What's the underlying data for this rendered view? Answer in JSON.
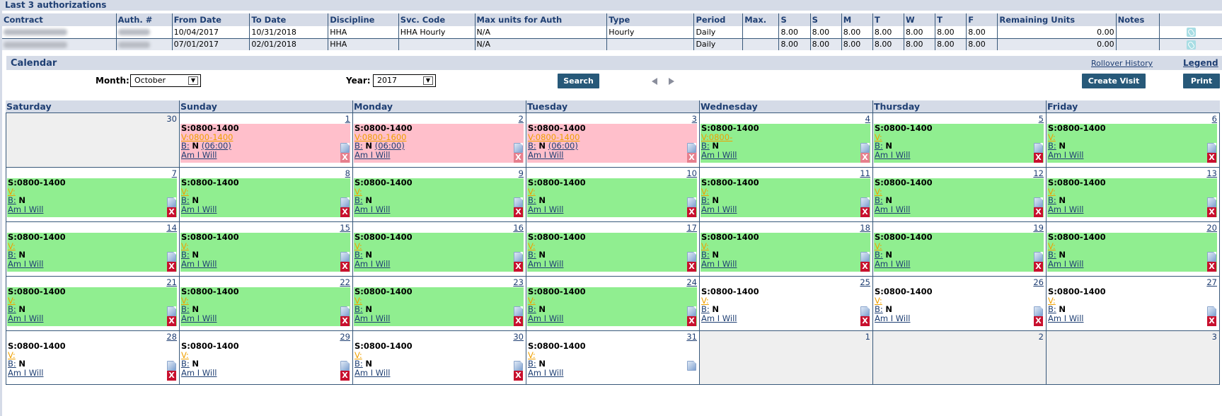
{
  "auth_section": {
    "title": "Last 3 authorizations",
    "columns": [
      "Contract",
      "Auth. #",
      "From Date",
      "To Date",
      "Discipline",
      "Svc. Code",
      "Max units for Auth",
      "Type",
      "Period",
      "Max.",
      "S",
      "S",
      "M",
      "T",
      "W",
      "T",
      "F",
      "Remaining Units",
      "Notes",
      ""
    ],
    "rows": [
      {
        "contract": "",
        "auth": "",
        "from": "10/04/2017",
        "to": "10/31/2018",
        "discipline": "HHA",
        "svc_code": "HHA Hourly",
        "max_units": "N/A",
        "type": "Hourly",
        "period": "Daily",
        "max": "",
        "sat": "8.00",
        "sun": "8.00",
        "mon": "8.00",
        "tue": "8.00",
        "wed": "8.00",
        "thu": "8.00",
        "fri": "8.00",
        "remaining": "0.00",
        "notes": "",
        "icon": "attachment-icon"
      },
      {
        "contract": "",
        "auth": "",
        "from": "07/01/2017",
        "to": "02/01/2018",
        "discipline": "HHA",
        "svc_code": "",
        "max_units": "N/A",
        "type": "",
        "period": "Daily",
        "max": "",
        "sat": "8.00",
        "sun": "8.00",
        "mon": "8.00",
        "tue": "8.00",
        "wed": "8.00",
        "thu": "8.00",
        "fri": "8.00",
        "remaining": "0.00",
        "notes": "",
        "icon": "attachment-icon"
      }
    ]
  },
  "calendar": {
    "title": "Calendar",
    "rollover_label": "Rollover History",
    "legend_label": "Legend",
    "month_label": "Month:",
    "month_value": "October",
    "year_label": "Year:",
    "year_value": "2017",
    "search_label": "Search",
    "create_visit_label": "Create Visit",
    "print_label": "Print",
    "days_of_week": [
      "Saturday",
      "Sunday",
      "Monday",
      "Tuesday",
      "Wednesday",
      "Thursday",
      "Friday"
    ],
    "colors": {
      "pink": "#ffbfcb",
      "green": "#90ee90",
      "header": "#d5dbe7",
      "accent": "#1f3f73",
      "button": "#275979"
    },
    "weeks": [
      [
        {
          "day": "30",
          "other": true
        },
        {
          "day": "1",
          "status": "pink",
          "sched": "S:0800-1400",
          "visit": "V:0800-1400",
          "b_label": "B:",
          "b_value": "N",
          "b_extra": "(06:00)",
          "caregiver": "Am I Will",
          "del_faded": true
        },
        {
          "day": "2",
          "status": "pink",
          "sched": "S:0800-1400",
          "visit": "V:0800-1600",
          "b_label": "B:",
          "b_value": "N",
          "b_extra": "(06:00)",
          "caregiver": "Am I Will",
          "del_faded": true
        },
        {
          "day": "3",
          "status": "pink",
          "sched": "S:0800-1400",
          "visit": "V:0800-1400",
          "b_label": "B:",
          "b_value": "N",
          "b_extra": "(06:00)",
          "caregiver": "Am I Will",
          "del_faded": true
        },
        {
          "day": "4",
          "status": "green",
          "sched": "S:0800-1400",
          "visit": "V:0800-",
          "b_label": "B:",
          "b_value": "N",
          "b_extra": "",
          "caregiver": "Am I Will",
          "del_faded": true
        },
        {
          "day": "5",
          "status": "green",
          "sched": "S:0800-1400",
          "visit": "V:",
          "b_label": "B:",
          "b_value": "N",
          "b_extra": "",
          "caregiver": "Am I Will"
        },
        {
          "day": "6",
          "status": "green",
          "sched": "S:0800-1400",
          "visit": "V:",
          "b_label": "B:",
          "b_value": "N",
          "b_extra": "",
          "caregiver": "Am I Will"
        }
      ],
      [
        {
          "day": "7",
          "status": "green",
          "sched": "S:0800-1400",
          "visit": "V:",
          "b_label": "B:",
          "b_value": "N",
          "b_extra": "",
          "caregiver": "Am I Will"
        },
        {
          "day": "8",
          "status": "green",
          "sched": "S:0800-1400",
          "visit": "V:",
          "b_label": "B:",
          "b_value": "N",
          "b_extra": "",
          "caregiver": "Am I Will"
        },
        {
          "day": "9",
          "status": "green",
          "sched": "S:0800-1400",
          "visit": "V:",
          "b_label": "B:",
          "b_value": "N",
          "b_extra": "",
          "caregiver": "Am I Will"
        },
        {
          "day": "10",
          "status": "green",
          "sched": "S:0800-1400",
          "visit": "V:",
          "b_label": "B:",
          "b_value": "N",
          "b_extra": "",
          "caregiver": "Am I Will"
        },
        {
          "day": "11",
          "status": "green",
          "sched": "S:0800-1400",
          "visit": "V:",
          "b_label": "B:",
          "b_value": "N",
          "b_extra": "",
          "caregiver": "Am I Will"
        },
        {
          "day": "12",
          "status": "green",
          "sched": "S:0800-1400",
          "visit": "V:",
          "b_label": "B:",
          "b_value": "N",
          "b_extra": "",
          "caregiver": "Am I Will"
        },
        {
          "day": "13",
          "status": "green",
          "sched": "S:0800-1400",
          "visit": "V:",
          "b_label": "B:",
          "b_value": "N",
          "b_extra": "",
          "caregiver": "Am I Will"
        }
      ],
      [
        {
          "day": "14",
          "status": "green",
          "sched": "S:0800-1400",
          "visit": "V:",
          "b_label": "B:",
          "b_value": "N",
          "b_extra": "",
          "caregiver": "Am I Will"
        },
        {
          "day": "15",
          "status": "green",
          "sched": "S:0800-1400",
          "visit": "V:",
          "b_label": "B:",
          "b_value": "N",
          "b_extra": "",
          "caregiver": "Am I Will"
        },
        {
          "day": "16",
          "status": "green",
          "sched": "S:0800-1400",
          "visit": "V:",
          "b_label": "B:",
          "b_value": "N",
          "b_extra": "",
          "caregiver": "Am I Will"
        },
        {
          "day": "17",
          "status": "green",
          "sched": "S:0800-1400",
          "visit": "V:",
          "b_label": "B:",
          "b_value": "N",
          "b_extra": "",
          "caregiver": "Am I Will"
        },
        {
          "day": "18",
          "status": "green",
          "sched": "S:0800-1400",
          "visit": "V:",
          "b_label": "B:",
          "b_value": "N",
          "b_extra": "",
          "caregiver": "Am I Will"
        },
        {
          "day": "19",
          "status": "green",
          "sched": "S:0800-1400",
          "visit": "V:",
          "b_label": "B:",
          "b_value": "N",
          "b_extra": "",
          "caregiver": "Am I Will"
        },
        {
          "day": "20",
          "status": "green",
          "sched": "S:0800-1400",
          "visit": "V:",
          "b_label": "B:",
          "b_value": "N",
          "b_extra": "",
          "caregiver": "Am I Will"
        }
      ],
      [
        {
          "day": "21",
          "status": "green",
          "sched": "S:0800-1400",
          "visit": "V:",
          "b_label": "B:",
          "b_value": "N",
          "b_extra": "",
          "caregiver": "Am I Will"
        },
        {
          "day": "22",
          "status": "green",
          "sched": "S:0800-1400",
          "visit": "V:",
          "b_label": "B:",
          "b_value": "N",
          "b_extra": "",
          "caregiver": "Am I Will"
        },
        {
          "day": "23",
          "status": "green",
          "sched": "S:0800-1400",
          "visit": "V:",
          "b_label": "B:",
          "b_value": "N",
          "b_extra": "",
          "caregiver": "Am I Will"
        },
        {
          "day": "24",
          "status": "green",
          "sched": "S:0800-1400",
          "visit": "V:",
          "b_label": "B:",
          "b_value": "N",
          "b_extra": "",
          "caregiver": "Am I Will"
        },
        {
          "day": "25",
          "status": "white",
          "sched": "S:0800-1400",
          "visit": "V:",
          "b_label": "B:",
          "b_value": "N",
          "b_extra": "",
          "caregiver": "Am I Will"
        },
        {
          "day": "26",
          "status": "white",
          "sched": "S:0800-1400",
          "visit": "V:",
          "b_label": "B:",
          "b_value": "N",
          "b_extra": "",
          "caregiver": "Am I Will"
        },
        {
          "day": "27",
          "status": "white",
          "sched": "S:0800-1400",
          "visit": "V:",
          "b_label": "B:",
          "b_value": "N",
          "b_extra": "",
          "caregiver": "Am I Will"
        }
      ],
      [
        {
          "day": "28",
          "status": "white",
          "sched": "S:0800-1400",
          "visit": "V:",
          "b_label": "B:",
          "b_value": "N",
          "b_extra": "",
          "caregiver": "Am I Will"
        },
        {
          "day": "29",
          "status": "white",
          "sched": "S:0800-1400",
          "visit": "V:",
          "b_label": "B:",
          "b_value": "N",
          "b_extra": "",
          "caregiver": "Am I Will"
        },
        {
          "day": "30",
          "status": "white",
          "sched": "S:0800-1400",
          "visit": "V:",
          "b_label": "B:",
          "b_value": "N",
          "b_extra": "",
          "caregiver": "Am I Will"
        },
        {
          "day": "31",
          "status": "white",
          "sched": "S:0800-1400",
          "visit": "V:",
          "b_label": "B:",
          "b_value": "N",
          "b_extra": "",
          "caregiver": "Am I Will",
          "no_delete": true
        },
        {
          "day": "1",
          "other": true
        },
        {
          "day": "2",
          "other": true
        },
        {
          "day": "3",
          "other": true
        }
      ]
    ]
  }
}
